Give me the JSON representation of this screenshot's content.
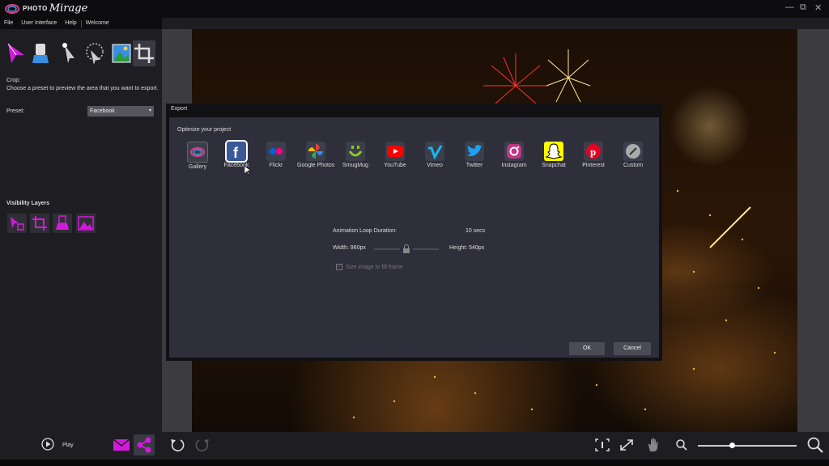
{
  "app": {
    "brand_small": "PHOTO",
    "brand_large": "Mirage",
    "minimize": "—",
    "restore": "⧉",
    "close": "✕"
  },
  "menu": {
    "file": "File",
    "user_interface": "User Interface",
    "help": "Help",
    "welcome": "Welcome"
  },
  "left_panel": {
    "crop_title": "Crop:",
    "crop_description": "Choose a preset to preview the area that you want to export.",
    "preset_label": "Preset:",
    "preset_value": "Facebook",
    "visibility_layers_title": "Visibility Layers"
  },
  "bottom_bar": {
    "play_label": "Play",
    "zoom_level": 0.35
  },
  "dialog": {
    "title": "Export",
    "optimize_label": "Optimize your project",
    "targets": [
      {
        "label": "Gallery"
      },
      {
        "label": "Facebook"
      },
      {
        "label": "Flickr"
      },
      {
        "label": "Google Photos"
      },
      {
        "label": "SmugMug"
      },
      {
        "label": "YouTube"
      },
      {
        "label": "Vimeo"
      },
      {
        "label": "Twitter"
      },
      {
        "label": "Instagram"
      },
      {
        "label": "Snapchat"
      },
      {
        "label": "Pinterest"
      },
      {
        "label": "Custom"
      }
    ],
    "selected_target": "Facebook",
    "animation_loop_label": "Animation Loop Duration:",
    "animation_loop_value": "10 secs",
    "width_label": "Width: 960px",
    "height_label": "Height: 540px",
    "size_to_fill_label": "Size image to fill frame",
    "ok_label": "OK",
    "cancel_label": "Cancel"
  },
  "colors": {
    "accent_magenta": "#d21adb",
    "dialog_bg": "#2f2e3b",
    "panel_bg": "#1e1e22"
  }
}
